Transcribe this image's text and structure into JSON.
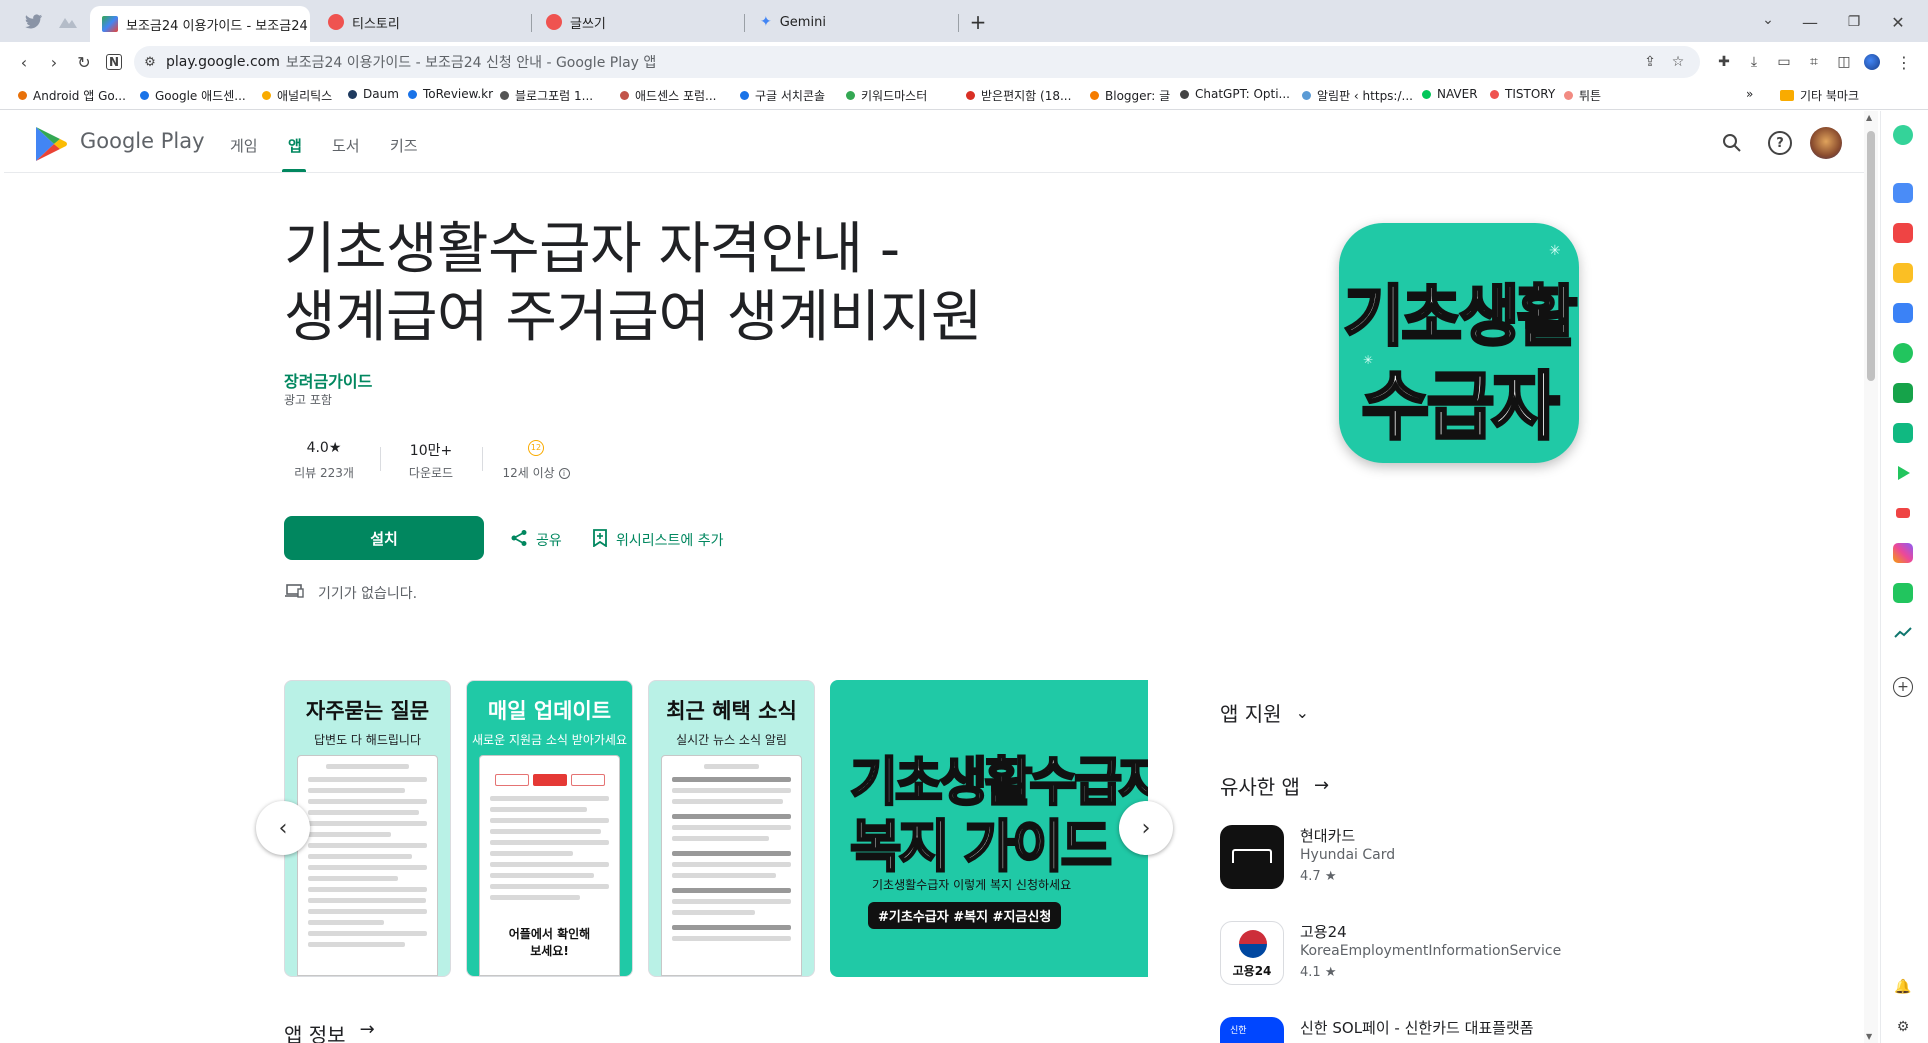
{
  "browser": {
    "tabs": [
      {
        "title": "보조금24 이용가이드 - 보조금24",
        "color": "#4285f4"
      },
      {
        "title": "티스토리",
        "color": "#ef5350"
      },
      {
        "title": "글쓰기",
        "color": "#ef5350"
      },
      {
        "title": "Gemini",
        "color": "#4285f4"
      }
    ],
    "url_host": "play.google.com",
    "url_title": "보조금24 이용가이드 - 보조금24 신청 안내 - Google Play 앱",
    "bookmarks": [
      {
        "label": "Android 앱 Go...",
        "color": "#e8710a"
      },
      {
        "label": "Google 애드센...",
        "color": "#1a73e8"
      },
      {
        "label": "애널리틱스",
        "color": "#f9ab00"
      },
      {
        "label": "Daum",
        "color": "#1f3a5f"
      },
      {
        "label": "ToReview.kr",
        "color": "#1a73e8"
      },
      {
        "label": "블로그포럼 1...",
        "color": "#555555"
      },
      {
        "label": "애드센스 포럼...",
        "color": "#c2544a"
      },
      {
        "label": "구글 서치콘솔",
        "color": "#1a73e8"
      },
      {
        "label": "키워드마스터",
        "color": "#34a853"
      },
      {
        "label": "받은편지함 (18...",
        "color": "#d93025"
      },
      {
        "label": "Blogger: 글",
        "color": "#f57c00"
      },
      {
        "label": "ChatGPT: Opti...",
        "color": "#444444"
      },
      {
        "label": "알림판 ‹ https:/...",
        "color": "#5b9bd5"
      },
      {
        "label": "NAVER",
        "color": "#03c75a"
      },
      {
        "label": "TISTORY",
        "color": "#ef5350"
      },
      {
        "label": "튀튼",
        "color": "#f28b82"
      }
    ],
    "bookmarks_more": "»",
    "other_bookmarks": "기타 북마크"
  },
  "gp": {
    "logo_text": "Google Play",
    "nav": [
      "게임",
      "앱",
      "도서",
      "키즈"
    ],
    "active_nav": "앱",
    "colors": {
      "accent": "#01875f",
      "icon_bg": "#20c9a6"
    }
  },
  "app": {
    "title_line1": "기초생활수급자 자격안내 -",
    "title_line2": "생계급여 주거급여 생계비지원",
    "developer": "장려금가이드",
    "ads": "광고 포함",
    "rating": "4.0★",
    "reviews": "리뷰 223개",
    "downloads": "10만+",
    "downloads_label": "다운로드",
    "age_badge": "12",
    "age_label": "12세 이상",
    "install": "설치",
    "share": "공유",
    "wishlist": "위시리스트에 추가",
    "no_device": "기기가 없습니다.",
    "icon_line1": "기초생활",
    "icon_line2": "수급자"
  },
  "screenshots": [
    {
      "heading": "자주묻는 질문",
      "sub": "답변도 다 해드립니다",
      "bg": "#b9f1e6"
    },
    {
      "heading": "매일 업데이트",
      "sub": "새로운 지원금 소식 받아가세요",
      "bg": "#20c9a6",
      "footer": "어플에서 확인해보세요!"
    },
    {
      "heading": "최근 혜택 소식",
      "sub": "실시간 뉴스 소식 알림",
      "bg": "#b9f1e6"
    },
    {
      "line1": "기초생활수급자",
      "line2": "복지 가이드",
      "sub": "기초생활수급자 이렇게 복지 신청하세요",
      "tags": "#기초수급자 #복지 #지금신청",
      "bg": "#20c9a6"
    }
  ],
  "side": {
    "app_support": "앱 지원",
    "similar": "유사한 앱",
    "similar_apps": [
      {
        "name": "현대카드",
        "dev": "Hyundai Card",
        "rating": "4.7"
      },
      {
        "name": "고용24",
        "dev": "KoreaEmploymentInformationService",
        "rating": "4.1"
      },
      {
        "name": "신한 SOL페이 - 신한카드 대표플랫폼",
        "dev": "",
        "rating": ""
      }
    ]
  },
  "about": "앱 정보"
}
